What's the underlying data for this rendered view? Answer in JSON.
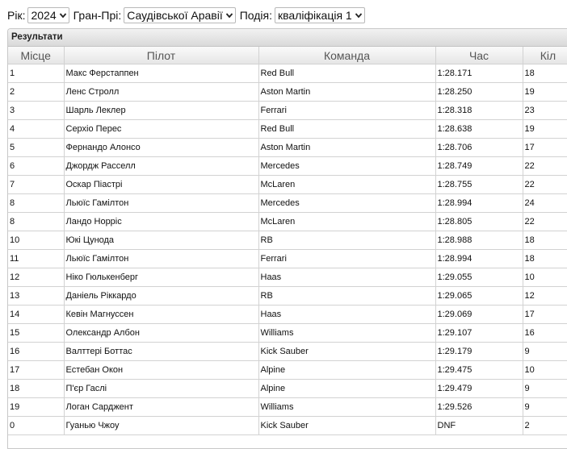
{
  "filters": {
    "year_label": "Рік:",
    "year_value": "2024",
    "gp_label": "Гран-Прі:",
    "gp_value": "Саудівської Аравії",
    "event_label": "Подія:",
    "event_value": "кваліфікація 1"
  },
  "panel": {
    "title": "Результати"
  },
  "table": {
    "headers": [
      "Місце",
      "Пілот",
      "Команда",
      "Час",
      "Кіл"
    ],
    "rows": [
      [
        "1",
        "Макс Ферстаппен",
        "Red Bull",
        "1:28.171",
        "18"
      ],
      [
        "2",
        "Ленс Стролл",
        "Aston Martin",
        "1:28.250",
        "19"
      ],
      [
        "3",
        "Шарль Леклер",
        "Ferrari",
        "1:28.318",
        "23"
      ],
      [
        "4",
        "Серхіо Перес",
        "Red Bull",
        "1:28.638",
        "19"
      ],
      [
        "5",
        "Фернандо Алонсо",
        "Aston Martin",
        "1:28.706",
        "17"
      ],
      [
        "6",
        "Джордж Расселл",
        "Mercedes",
        "1:28.749",
        "22"
      ],
      [
        "7",
        "Оскар Піастрі",
        "McLaren",
        "1:28.755",
        "22"
      ],
      [
        "8",
        "Льюїс Гамілтон",
        "Mercedes",
        "1:28.994",
        "24"
      ],
      [
        "8",
        "Ландо Норріс",
        "McLaren",
        "1:28.805",
        "22"
      ],
      [
        "10",
        "Юкі Цунода",
        "RB",
        "1:28.988",
        "18"
      ],
      [
        "11",
        "Льюїс Гамілтон",
        "Ferrari",
        "1:28.994",
        "18"
      ],
      [
        "12",
        "Ніко Гюлькенберг",
        "Haas",
        "1:29.055",
        "10"
      ],
      [
        "13",
        "Даніель Ріккардо",
        "RB",
        "1:29.065",
        "12"
      ],
      [
        "14",
        "Кевін Магнуссен",
        "Haas",
        "1:29.069",
        "17"
      ],
      [
        "15",
        "Олександр Албон",
        "Williams",
        "1:29.107",
        "16"
      ],
      [
        "16",
        "Валттері Боттас",
        "Kick Sauber",
        "1:29.179",
        "9"
      ],
      [
        "17",
        "Естебан Окон",
        "Alpine",
        "1:29.475",
        "10"
      ],
      [
        "18",
        "П'єр Гаслі",
        "Alpine",
        "1:29.479",
        "9"
      ],
      [
        "19",
        "Логан Сарджент",
        "Williams",
        "1:29.526",
        "9"
      ],
      [
        "0",
        "Гуанью Чжоу",
        "Kick Sauber",
        "DNF",
        "2"
      ]
    ]
  }
}
